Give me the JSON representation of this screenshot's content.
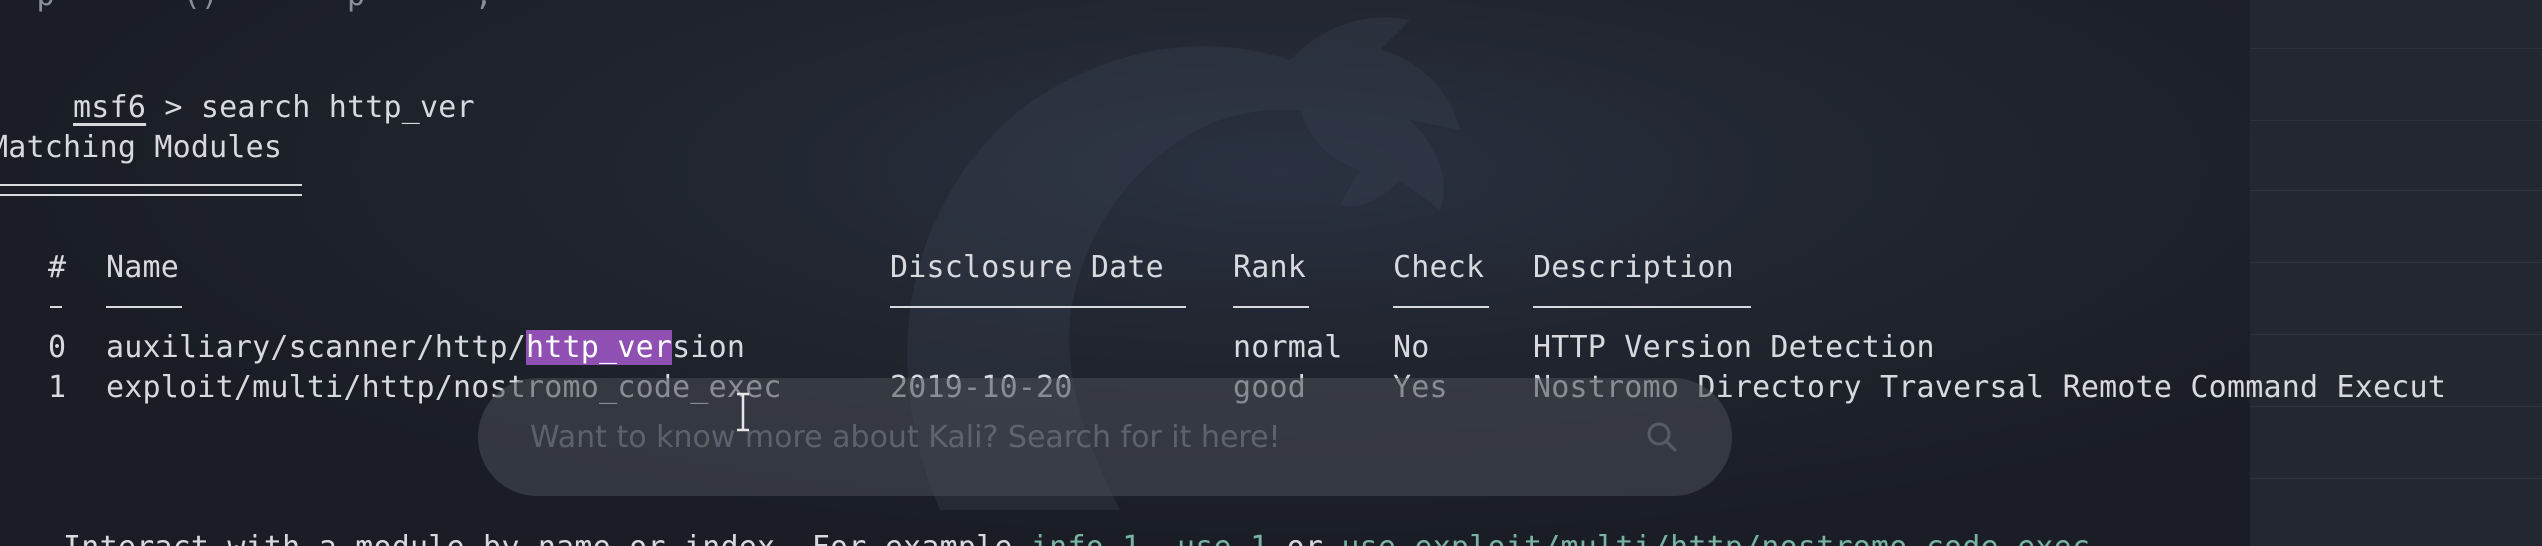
{
  "top_partial": "  p       ()       p      ,",
  "prompt": {
    "name": "msf6",
    "arrow": " > ",
    "command": "search http_ver"
  },
  "section_title": "Matching Modules",
  "table": {
    "headers": {
      "num": "#",
      "name": "Name",
      "date": "Disclosure Date",
      "rank": "Rank",
      "check": "Check",
      "desc": "Description"
    },
    "rows": [
      {
        "num": "0",
        "name_pre": "auxiliary/scanner/http/",
        "name_hl": "http_ver",
        "name_post": "sion",
        "date": "",
        "rank": "normal",
        "check": "No",
        "desc": "HTTP Version Detection"
      },
      {
        "num": "1",
        "name_pre": "exploit/multi/http/nostromo_code_exec",
        "name_hl": "",
        "name_post": "",
        "date": "2019-10-20",
        "rank": "good",
        "check": "Yes",
        "desc": "Nostromo Directory Traversal Remote Command Execut"
      }
    ]
  },
  "hint": {
    "prefix": "Interact with a module by name or index. For example ",
    "cmd1": "info 1",
    "sep1": ", ",
    "cmd2": "use 1",
    "sep2": " or ",
    "cmd3": "use exploit/multi/http/nostromo_code_exec"
  },
  "search_overlay": {
    "placeholder": "Want to know more about Kali? Search for it here!"
  },
  "icons": {
    "search": "search-icon",
    "cursor": "text-cursor-icon",
    "watermark": "kali-dragon-icon"
  },
  "colors": {
    "background": "#1b1e27",
    "text": "#d7d9de",
    "highlight": "#8f4fb3",
    "command": "#79b4a2"
  }
}
